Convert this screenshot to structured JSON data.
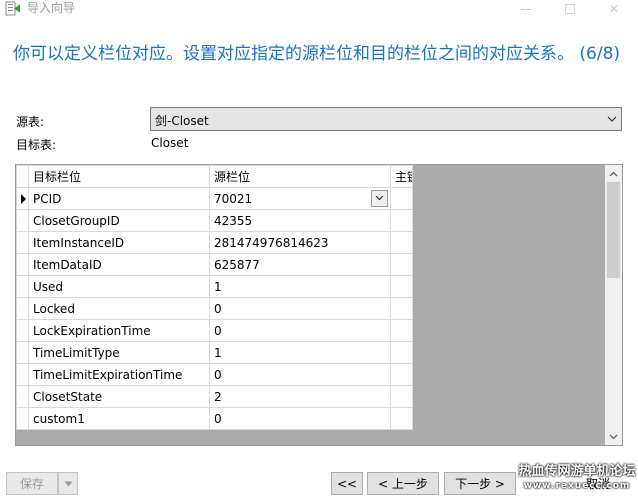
{
  "window": {
    "title": "导入向导"
  },
  "heading": "你可以定义栏位对应。设置对应指定的源栏位和目的栏位之间的对应关系。 (6/8)",
  "source": {
    "label": "源表:",
    "value": "剑-Closet"
  },
  "target": {
    "label": "目标表:",
    "value": "Closet"
  },
  "grid": {
    "columns": [
      "目标栏位",
      "源栏位",
      "主键"
    ],
    "rows": [
      {
        "target": "PCID",
        "source": "70021",
        "key": ""
      },
      {
        "target": "ClosetGroupID",
        "source": "42355",
        "key": ""
      },
      {
        "target": "ItemInstanceID",
        "source": "281474976814623",
        "key": ""
      },
      {
        "target": "ItemDataID",
        "source": "625877",
        "key": ""
      },
      {
        "target": "Used",
        "source": "1",
        "key": ""
      },
      {
        "target": "Locked",
        "source": "0",
        "key": ""
      },
      {
        "target": "LockExpirationTime",
        "source": "0",
        "key": ""
      },
      {
        "target": "TimeLimitType",
        "source": "1",
        "key": ""
      },
      {
        "target": "TimeLimitExpirationTime",
        "source": "0",
        "key": ""
      },
      {
        "target": "ClosetState",
        "source": "2",
        "key": ""
      },
      {
        "target": "custom1",
        "source": "0",
        "key": ""
      }
    ]
  },
  "buttons": {
    "save": "保存",
    "first": "<<",
    "prev": "< 上一步",
    "next": "下一步 >",
    "cancel": "取消"
  },
  "watermark": {
    "line1": "热血传网游单机论坛",
    "line2": "www.rexuecc.com"
  },
  "colors": {
    "heading": "#1a72c5",
    "grid_background": "#ababab"
  }
}
